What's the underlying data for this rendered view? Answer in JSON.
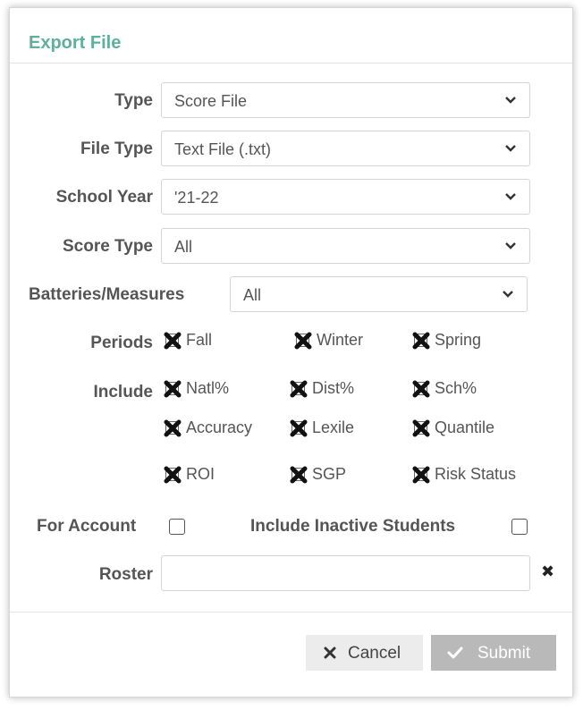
{
  "dialog": {
    "title": "Export File"
  },
  "fields": {
    "type": {
      "label": "Type",
      "value": "Score File"
    },
    "file_type": {
      "label": "File Type",
      "value": "Text File (.txt)"
    },
    "school_year": {
      "label": "School Year",
      "value": "'21-22"
    },
    "score_type": {
      "label": "Score Type",
      "value": "All"
    },
    "batteries": {
      "label": "Batteries/Measures",
      "value": "All"
    }
  },
  "periods": {
    "label": "Periods",
    "options": [
      {
        "label": "Fall",
        "checked": true
      },
      {
        "label": "Winter",
        "checked": true
      },
      {
        "label": "Spring",
        "checked": true
      }
    ]
  },
  "include": {
    "label": "Include",
    "options": [
      {
        "label": "Natl%",
        "checked": true
      },
      {
        "label": "Dist%",
        "checked": true
      },
      {
        "label": "Sch%",
        "checked": true
      },
      {
        "label": "Accuracy",
        "checked": true
      },
      {
        "label": "Lexile",
        "checked": true
      },
      {
        "label": "Quantile",
        "checked": true
      },
      {
        "label": "ROI",
        "checked": true
      },
      {
        "label": "SGP",
        "checked": true
      },
      {
        "label": "Risk Status",
        "checked": true
      }
    ]
  },
  "for_account": {
    "label": "For Account",
    "checked": false
  },
  "include_inactive": {
    "label": "Include Inactive Students",
    "checked": false
  },
  "roster": {
    "label": "Roster",
    "value": "",
    "clear_icon": "close-icon"
  },
  "footer": {
    "cancel_label": "Cancel",
    "cancel_icon": "close-icon",
    "submit_label": "Submit",
    "submit_icon": "check-icon"
  },
  "colors": {
    "title": "#5fae9e",
    "label": "#555555",
    "submit_bg": "#b9b9b9",
    "cancel_bg": "#ececec"
  }
}
